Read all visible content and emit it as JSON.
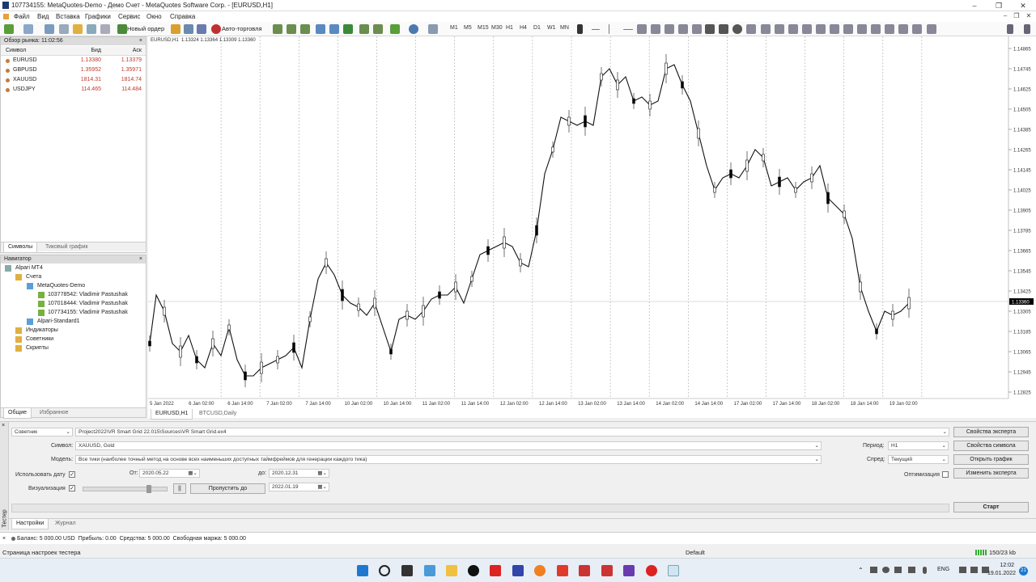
{
  "window": {
    "title": "107734155: MetaQuotes-Demo - Демо Счет - MetaQuotes Software Corp. - [EURUSD,H1]"
  },
  "menu": [
    "Файл",
    "Вид",
    "Вставка",
    "Графики",
    "Сервис",
    "Окно",
    "Справка"
  ],
  "toolbar": {
    "new_order": "Новый ордер",
    "autotrade": "Авто-торговля",
    "timeframes": [
      "M1",
      "M5",
      "M15",
      "M30",
      "H1",
      "H4",
      "D1",
      "W1",
      "MN"
    ]
  },
  "market_watch": {
    "title": "Обзор рынка: 11:02:56",
    "col_symbol": "Символ",
    "col_bid": "Бид",
    "col_ask": "Аск",
    "rows": [
      {
        "symbol": "EURUSD",
        "bid": "1.13380",
        "ask": "1.13379"
      },
      {
        "symbol": "GBPUSD",
        "bid": "1.35952",
        "ask": "1.35971"
      },
      {
        "symbol": "XAUUSD",
        "bid": "1814.31",
        "ask": "1814.74"
      },
      {
        "symbol": "USDJPY",
        "bid": "114.465",
        "ask": "114.484"
      }
    ],
    "tabs": [
      "Символы",
      "Тиковый график"
    ]
  },
  "navigator": {
    "title": "Навигатор",
    "items": [
      "Alpari MT4",
      "Счета",
      "MetaQuotes-Demo",
      "103778542: Vladimir Pastushak",
      "107018444: Vladimir Pastushak",
      "107734155: Vladimir Pastushak",
      "Alpari-Standard1",
      "Индикаторы",
      "Советники",
      "Скрипты"
    ],
    "tabs": [
      "Общие",
      "Избранное"
    ]
  },
  "chart": {
    "header": "EURUSD,H1  1.13324 1.13364 1.13309 1.13360",
    "current_price": "1.13360",
    "price_labels": [
      "1.14865",
      "1.14745",
      "1.14625",
      "1.14505",
      "1.14385",
      "1.14265",
      "1.14145",
      "1.14025",
      "1.13905",
      "1.13785",
      "1.13665",
      "1.13545",
      "1.13425",
      "1.13305",
      "1.13185",
      "1.13065",
      "1.12945",
      "1.12825"
    ],
    "time_labels": [
      "5 Jan 2022",
      "6 Jan 02:00",
      "6 Jan 14:00",
      "7 Jan 02:00",
      "7 Jan 14:00",
      "10 Jan 02:00",
      "10 Jan 14:00",
      "11 Jan 02:00",
      "11 Jan 14:00",
      "12 Jan 02:00",
      "12 Jan 14:00",
      "13 Jan 02:00",
      "13 Jan 14:00",
      "14 Jan 02:00",
      "14 Jan 14:00",
      "17 Jan 02:00",
      "17 Jan 14:00",
      "18 Jan 02:00",
      "18 Jan 14:00",
      "19 Jan 02:00"
    ],
    "tabs": [
      "EURUSD,H1",
      "BTCUSD,Daily"
    ]
  },
  "tester": {
    "side_label": "Тестер",
    "type": "Советник",
    "expert_path": "Project2022\\VR Smart Grid 22.015\\Sources\\VR Smart Grid.ex4",
    "symbol_label": "Символ:",
    "symbol": "XAUUSD, Gold",
    "model_label": "Модель:",
    "model": "Все тики (наиболее точный метод на основе всех наименьших доступных таймфреймов для генерации каждого тика)",
    "use_date": "Использовать дату",
    "from_label": "От:",
    "from": "2020.05.22",
    "to_label": "до:",
    "to": "2020.12.31",
    "visual": "Визуализация",
    "skip_btn": "Пропустить до",
    "skip_date": "2022.01.19",
    "pause": "||",
    "period_label": "Период:",
    "period": "H1",
    "spread_label": "Спред:",
    "spread": "Текущий",
    "optimization": "Оптимизация",
    "btn_expert_props": "Свойства эксперта",
    "btn_symbol_props": "Свойства символа",
    "btn_open_chart": "Открыть график",
    "btn_modify_expert": "Изменить эксперта",
    "btn_start": "Старт",
    "tabs": [
      "Настройки",
      "Журнал"
    ]
  },
  "account_line": "Баланс: 5 000.00 USD  Прибыль: 0.00  Средства: 5 000.00  Свободная маржа: 5 000.00",
  "statusbar": {
    "text": "Страница настроек тестера",
    "profile": "Default",
    "traffic": "150/23 kb"
  },
  "taskbar": {
    "lang": "ENG",
    "time": "12:02",
    "date": "19.01.2022",
    "badge": "21"
  },
  "colors": {
    "bull": "#ffffff",
    "bear": "#000000",
    "price_label": "#c0392b"
  }
}
